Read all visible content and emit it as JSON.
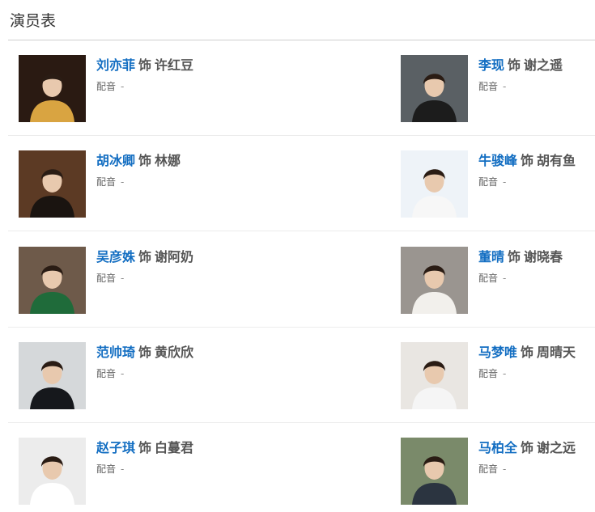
{
  "section": {
    "title": "演员表"
  },
  "cast": [
    {
      "actor": "刘亦菲",
      "shi": "饰",
      "role": "许红豆",
      "dub_label": "配音",
      "dub_value": "-",
      "photo_bg": "#2a1a12",
      "photo_fg": "#d9a441",
      "icon": "actor-photo"
    },
    {
      "actor": "李现",
      "shi": "饰",
      "role": "谢之遥",
      "dub_label": "配音",
      "dub_value": "-",
      "photo_bg": "#5a6064",
      "photo_fg": "#1c1c1c",
      "icon": "actor-photo"
    },
    {
      "actor": "胡冰卿",
      "shi": "饰",
      "role": "林娜",
      "dub_label": "配音",
      "dub_value": "-",
      "photo_bg": "#5c3a24",
      "photo_fg": "#1a1410",
      "icon": "actor-photo"
    },
    {
      "actor": "牛骏峰",
      "shi": "饰",
      "role": "胡有鱼",
      "dub_label": "配音",
      "dub_value": "-",
      "photo_bg": "#eef3f8",
      "photo_fg": "#f7f7f7",
      "icon": "actor-photo"
    },
    {
      "actor": "吴彦姝",
      "shi": "饰",
      "role": "谢阿奶",
      "dub_label": "配音",
      "dub_value": "-",
      "photo_bg": "#6e5a4a",
      "photo_fg": "#1f6b3a",
      "icon": "actor-photo"
    },
    {
      "actor": "董晴",
      "shi": "饰",
      "role": "谢晓春",
      "dub_label": "配音",
      "dub_value": "-",
      "photo_bg": "#9a9590",
      "photo_fg": "#f2f0ec",
      "icon": "actor-photo"
    },
    {
      "actor": "范帅琦",
      "shi": "饰",
      "role": "黄欣欣",
      "dub_label": "配音",
      "dub_value": "-",
      "photo_bg": "#d5d8da",
      "photo_fg": "#16181c",
      "icon": "actor-photo"
    },
    {
      "actor": "马梦唯",
      "shi": "饰",
      "role": "周晴天",
      "dub_label": "配音",
      "dub_value": "-",
      "photo_bg": "#e9e6e2",
      "photo_fg": "#f5f5f5",
      "icon": "actor-photo"
    },
    {
      "actor": "赵子琪",
      "shi": "饰",
      "role": "白蔓君",
      "dub_label": "配音",
      "dub_value": "-",
      "photo_bg": "#ececec",
      "photo_fg": "#ffffff",
      "icon": "actor-photo"
    },
    {
      "actor": "马柏全",
      "shi": "饰",
      "role": "谢之远",
      "dub_label": "配音",
      "dub_value": "-",
      "photo_bg": "#7a8a6a",
      "photo_fg": "#2b3440",
      "icon": "actor-photo"
    }
  ],
  "colors": {
    "link": "#136ec2",
    "text": "#555555",
    "divider": "#ececec"
  }
}
